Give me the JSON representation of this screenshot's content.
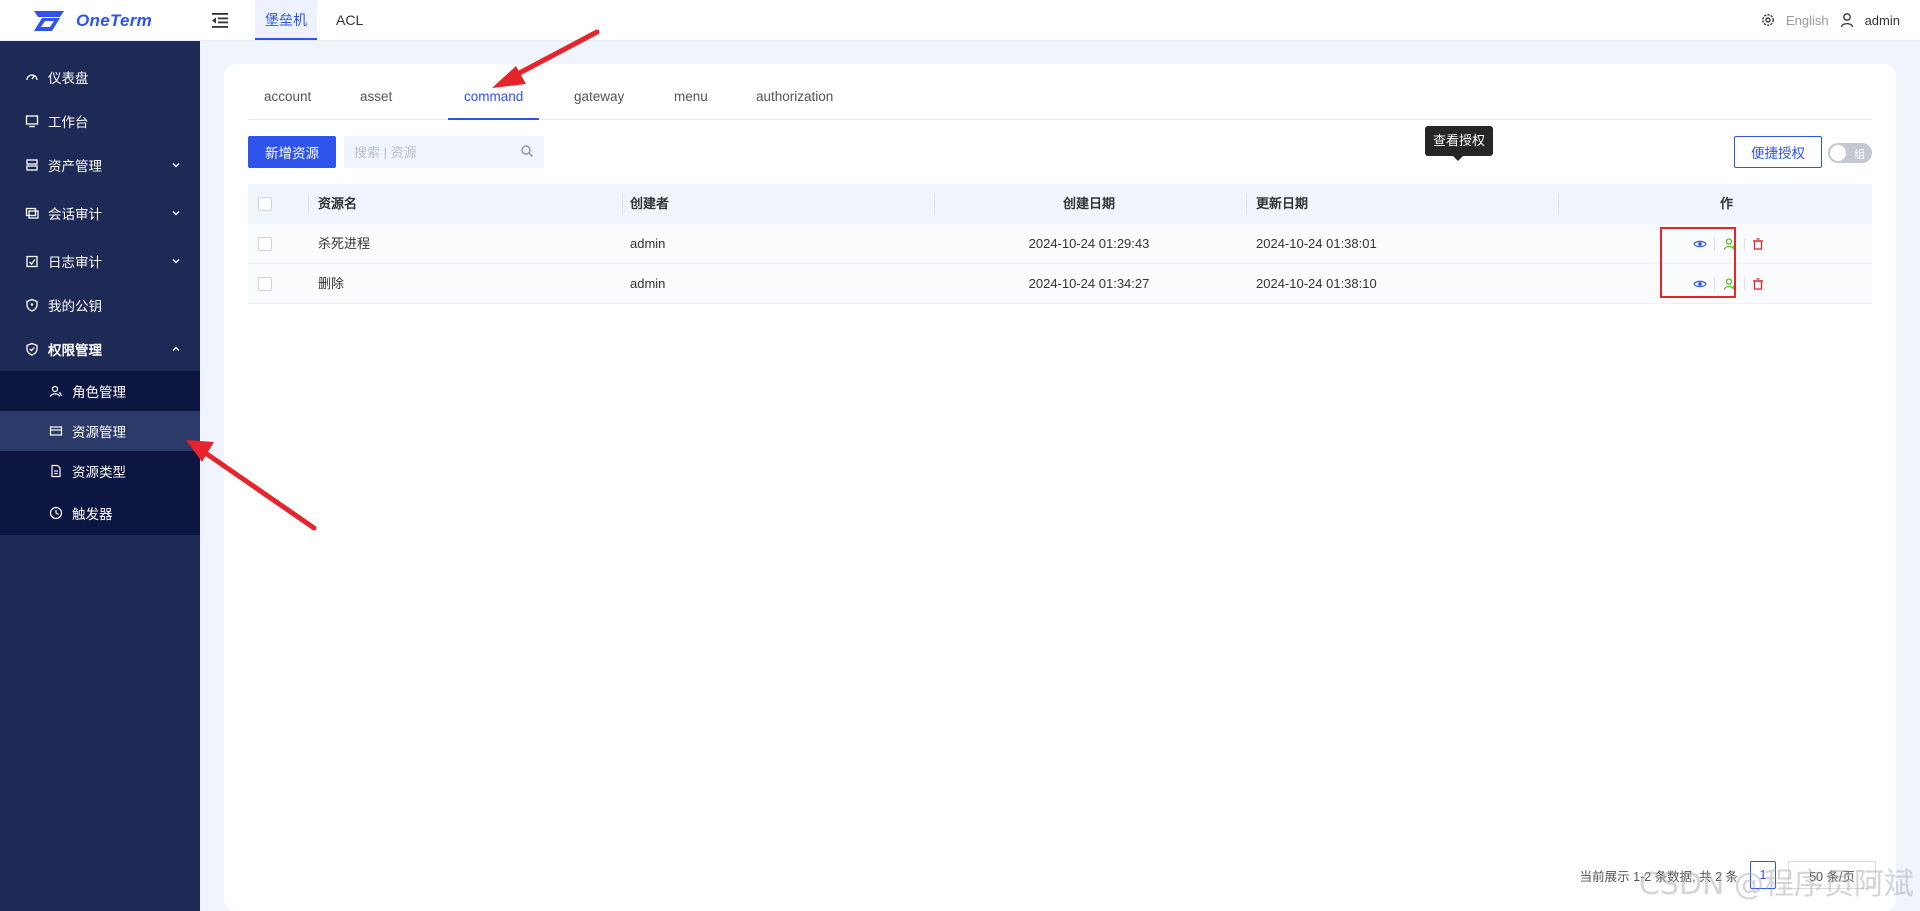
{
  "app": {
    "logo_text": "OneTerm"
  },
  "topnav": {
    "tabs": [
      {
        "label": "堡垒机"
      },
      {
        "label": "ACL"
      }
    ],
    "language": "English",
    "user": "admin"
  },
  "sidebar": {
    "items": [
      {
        "label": "仪表盘",
        "icon": "dashboard-icon"
      },
      {
        "label": "工作台",
        "icon": "monitor-icon"
      },
      {
        "label": "资产管理",
        "icon": "server-icon"
      },
      {
        "label": "会话审计",
        "icon": "session-icon"
      },
      {
        "label": "日志审计",
        "icon": "log-icon"
      },
      {
        "label": "我的公钥",
        "icon": "key-icon"
      },
      {
        "label": "权限管理",
        "icon": "shield-icon"
      }
    ],
    "subitems": [
      {
        "label": "角色管理",
        "icon": "role-icon"
      },
      {
        "label": "资源管理",
        "icon": "resource-icon"
      },
      {
        "label": "资源类型",
        "icon": "file-icon"
      },
      {
        "label": "触发器",
        "icon": "clock-icon"
      }
    ]
  },
  "tabs": [
    {
      "label": "account"
    },
    {
      "label": "asset"
    },
    {
      "label": "command"
    },
    {
      "label": "gateway"
    },
    {
      "label": "menu"
    },
    {
      "label": "authorization"
    }
  ],
  "toolbar": {
    "add_label": "新增资源",
    "search_placeholder": "搜索 | 资源",
    "grant_label": "便捷授权",
    "switch_label": "组"
  },
  "table": {
    "columns": [
      "资源名",
      "创建者",
      "创建日期",
      "更新日期",
      "作"
    ],
    "rows": [
      {
        "name": "杀死进程",
        "creator": "admin",
        "created": "2024-10-24 01:29:43",
        "updated": "2024-10-24 01:38:01"
      },
      {
        "name": "删除",
        "creator": "admin",
        "created": "2024-10-24 01:34:27",
        "updated": "2024-10-24 01:38:10"
      }
    ]
  },
  "tooltip": "查看授权",
  "pagination": {
    "summary": "当前展示 1-2 条数据, 共 2 条",
    "page": "1",
    "page_size": "50 条/页"
  },
  "watermark": "CSDN @程序员阿斌",
  "colors": {
    "primary": "#2f54eb",
    "sidebar": "#1e2a56",
    "submenu": "#0c1640",
    "danger": "#e5242b",
    "success": "#52c41a"
  }
}
